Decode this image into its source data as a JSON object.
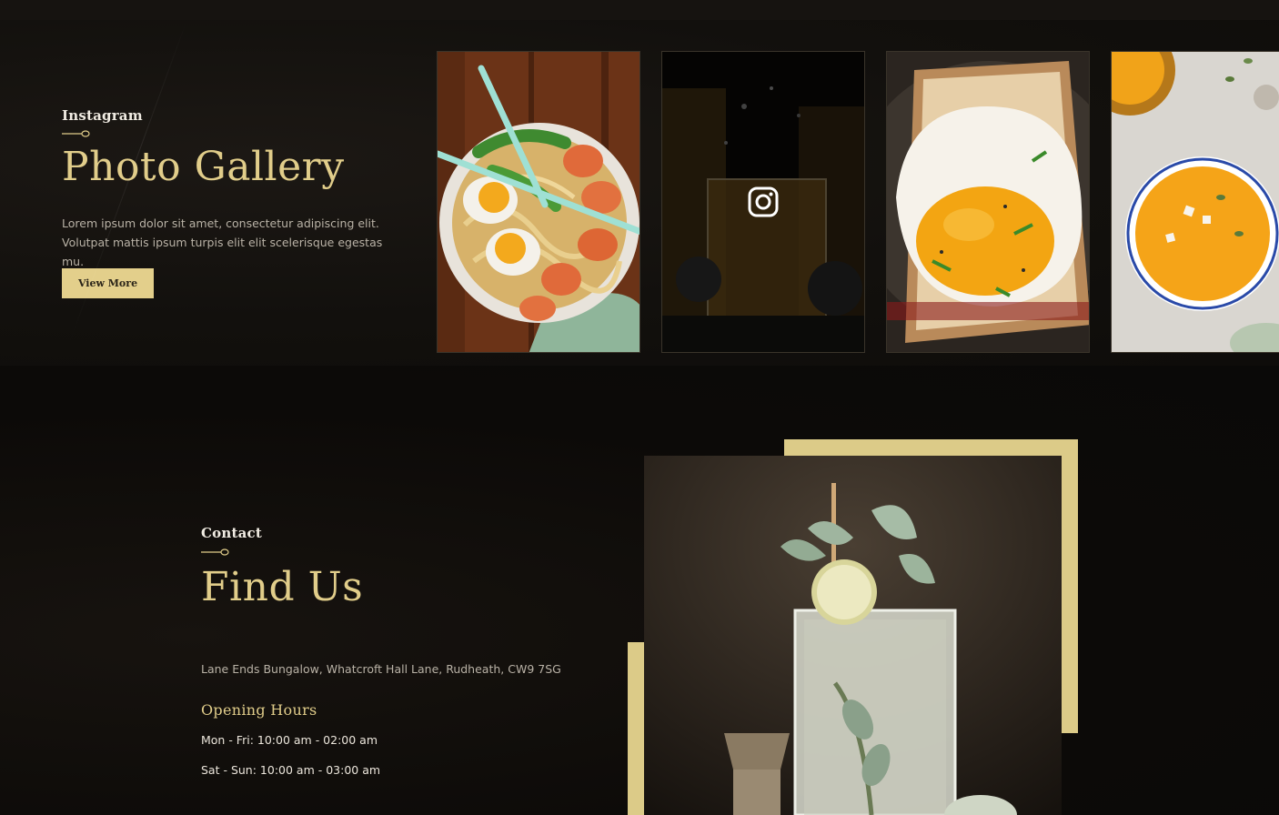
{
  "gallery": {
    "eyebrow": "Instagram",
    "title": "Photo Gallery",
    "description_line1": "Lorem ipsum dolor sit amet, consectetur adipiscing elit.",
    "description_line2": "Volutpat mattis ipsum turpis elit elit scelerisque egestas mu.",
    "button_label": "View More",
    "photos": [
      "ramen-bowl",
      "whiskey-splash",
      "fried-egg-toast",
      "pumpkin-soup"
    ],
    "overlay_icon": "instagram-icon"
  },
  "contact": {
    "eyebrow": "Contact",
    "title": "Find Us",
    "address": "Lane Ends Bungalow, Whatcroft Hall Lane, Rudheath, CW9 7SG",
    "hours_title": "Opening Hours",
    "hours": [
      "Mon - Fri: 10:00 am - 02:00 am",
      "Sat - Sun: 10:00 am - 03:00 am"
    ]
  },
  "colors": {
    "accent_gold": "#e1cd8a",
    "background": "#0d0b09",
    "text_light": "#cfc8bd"
  }
}
